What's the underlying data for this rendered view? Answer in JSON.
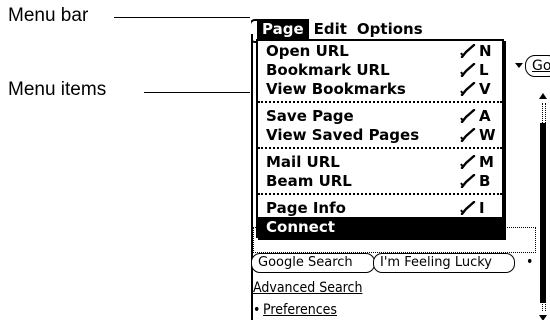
{
  "annotations": {
    "menu_bar_label": "Menu bar",
    "menu_items_label": "Menu items"
  },
  "menubar": {
    "items": [
      {
        "label": "Page",
        "active": true
      },
      {
        "label": "Edit",
        "active": false
      },
      {
        "label": "Options",
        "active": false
      }
    ]
  },
  "menu": {
    "groups": [
      [
        {
          "label": "Open URL",
          "key": "N"
        },
        {
          "label": "Bookmark URL",
          "key": "L"
        },
        {
          "label": "View Bookmarks",
          "key": "V"
        }
      ],
      [
        {
          "label": "Save Page",
          "key": "A"
        },
        {
          "label": "View Saved Pages",
          "key": "W"
        }
      ],
      [
        {
          "label": "Mail URL",
          "key": "M"
        },
        {
          "label": "Beam URL",
          "key": "B"
        }
      ],
      [
        {
          "label": "Page Info",
          "key": "I"
        },
        {
          "label": "Connect",
          "key": "",
          "highlighted": true
        }
      ]
    ],
    "shortcut_icon": "command-stroke-icon"
  },
  "background": {
    "go_button": "Go",
    "google_search_button": "Google Search",
    "feeling_lucky_button": "I'm Feeling Lucky",
    "advanced_search_link": "Advanced Search",
    "preferences_link": "Preferences",
    "bullet": "•"
  }
}
